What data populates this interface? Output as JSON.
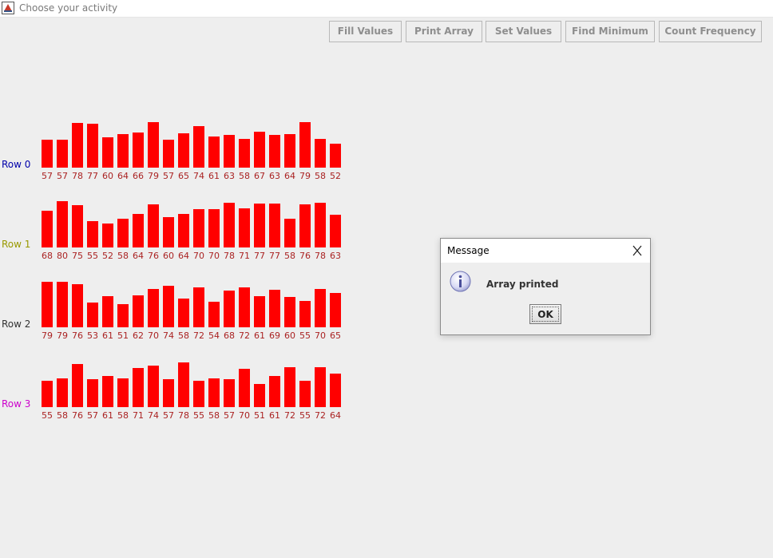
{
  "window": {
    "title": "Choose your activity"
  },
  "toolbar": {
    "buttons": [
      "Fill Values",
      "Print Array",
      "Set Values",
      "Find Minimum",
      "Count Frequency"
    ]
  },
  "rows": [
    {
      "label": "Row 0",
      "color": "#0000aa"
    },
    {
      "label": "Row 1",
      "color": "#999900"
    },
    {
      "label": "Row 2",
      "color": "#333333"
    },
    {
      "label": "Row 3",
      "color": "#cc00cc"
    }
  ],
  "chart_data": {
    "type": "bar",
    "bar_color": "#ff0000",
    "value_label_color": "#aa2222",
    "series": [
      {
        "name": "Row 0",
        "values": [
          57,
          57,
          78,
          77,
          60,
          64,
          66,
          79,
          57,
          65,
          74,
          61,
          63,
          58,
          67,
          63,
          64,
          79,
          58,
          52
        ]
      },
      {
        "name": "Row 1",
        "values": [
          68,
          80,
          75,
          55,
          52,
          58,
          64,
          76,
          60,
          64,
          70,
          70,
          78,
          71,
          77,
          77,
          58,
          76,
          78,
          63
        ]
      },
      {
        "name": "Row 2",
        "values": [
          79,
          79,
          76,
          53,
          61,
          51,
          62,
          70,
          74,
          58,
          72,
          54,
          68,
          72,
          61,
          69,
          60,
          55,
          70,
          65
        ]
      },
      {
        "name": "Row 3",
        "values": [
          55,
          58,
          76,
          57,
          61,
          58,
          71,
          74,
          57,
          78,
          55,
          58,
          57,
          70,
          51,
          61,
          72,
          55,
          72,
          64
        ]
      }
    ]
  },
  "dialog": {
    "title": "Message",
    "message": "Array printed",
    "ok_label": "OK",
    "icon": "info-icon"
  }
}
